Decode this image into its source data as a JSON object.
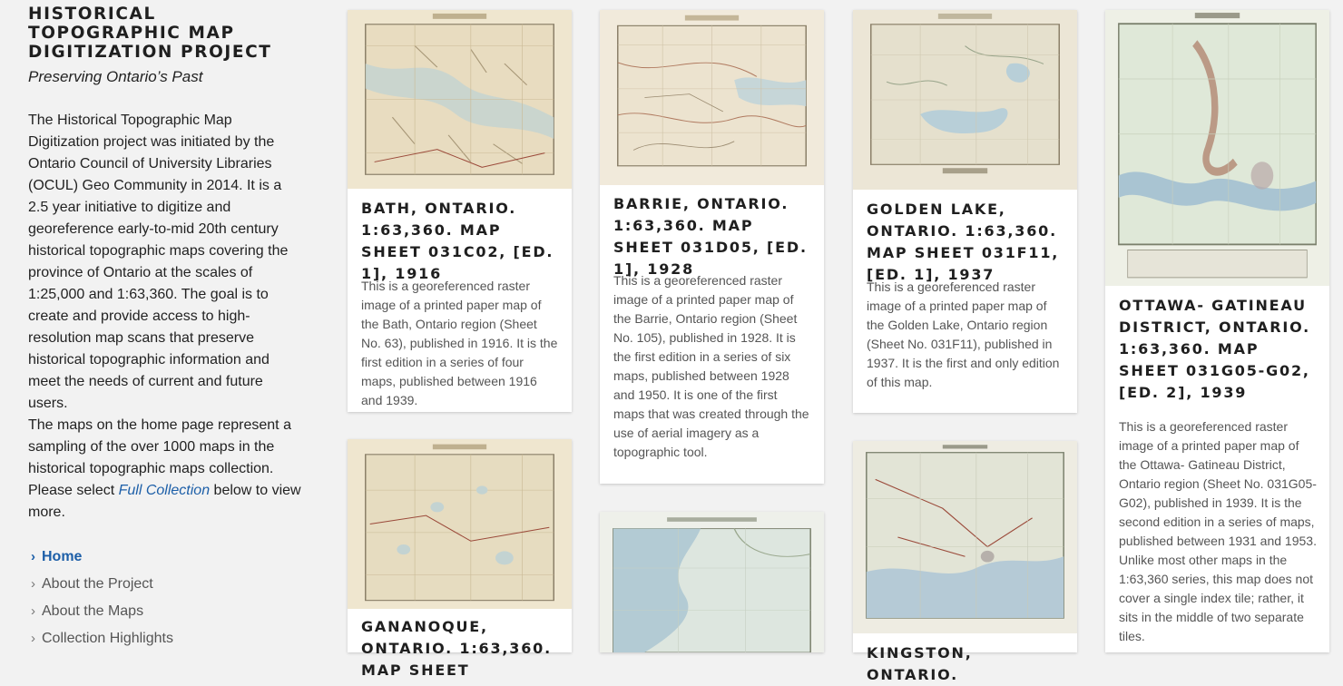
{
  "sidebar": {
    "title": "Historical Topographic Map Digitization Project",
    "tagline": "Preserving Ontario’s Past",
    "intro": "The Historical Topographic Map Digitization project was initiated by the Ontario Council of University Libraries (OCUL) Geo Community in 2014. It is a 2.5 year initiative to digitize and georeference early-to-mid 20th century historical topographic maps covering the province of Ontario at the scales of 1:25,000 and 1:63,360. The goal is to create and provide access to high-resolution map scans that preserve historical topographic information and meet the needs of current and future users.",
    "sampling_before": "The maps on the home page represent a sampling of the over 1000 maps in the historical topographic maps collection. Please select ",
    "sampling_link": "Full Collection",
    "sampling_after": " below to view more.",
    "nav": [
      {
        "label": "Home",
        "active": true
      },
      {
        "label": "About the Project",
        "active": false
      },
      {
        "label": "About the Maps",
        "active": false
      },
      {
        "label": "Collection Highlights",
        "active": false
      }
    ]
  },
  "cards": [
    {
      "title": "Bath, Ontario. 1:63,360. Map sheet 031C02, [ed. 1], 1916",
      "description": "This is a georeferenced raster image of a printed paper map of the Bath, Ontario region (Sheet No. 63), published in 1916. It is the first edition in a series of four maps, published between 1916 and 1939."
    },
    {
      "title": "Barrie, Ontario. 1:63,360. Map sheet 031D05, [ed. 1], 1928",
      "description": "This is a georeferenced raster image of a printed paper map of the Barrie, Ontario region (Sheet No. 105), published in 1928. It is the first edition in a series of six maps, published between 1928 and 1950. It is one of the first maps that was created through the use of aerial imagery as a topographic tool."
    },
    {
      "title": "Golden Lake, Ontario. 1:63,360. Map sheet 031F11, [ed. 1], 1937",
      "description": "This is a georeferenced raster image of a printed paper map of the Golden Lake, Ontario region (Sheet No. 031F11), published in 1937. It is the first and only edition of this map."
    },
    {
      "title": "Ottawa- Gatineau District, Ontario. 1:63,360. Map sheet 031G05-G02, [ed. 2], 1939",
      "description": "This is a georeferenced raster image of a printed paper map of the Ottawa- Gatineau District, Ontario region (Sheet No. 031G05-G02), published in 1939. It is the second edition in a series of maps, published between 1931 and 1953. Unlike most other maps in the 1:63,360 series, this map does not cover a single index tile; rather, it sits in the middle of two separate tiles."
    },
    {
      "title": "Gananoque, Ontario. 1:63,360. Map sheet",
      "description": ""
    },
    {
      "title": "",
      "description": ""
    },
    {
      "title": "Kingston, Ontario.",
      "description": ""
    }
  ],
  "colors": {
    "link": "#1d5fa8",
    "paper": "#efe6cf",
    "water": "#b9d0dc"
  }
}
